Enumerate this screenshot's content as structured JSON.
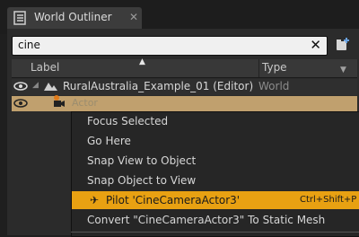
{
  "tab": {
    "title": "World Outliner",
    "close": "✕"
  },
  "search": {
    "value": "cine",
    "clear": "✕"
  },
  "columns": {
    "label": "Label",
    "type": "Type"
  },
  "rows": [
    {
      "label": "RuralAustralia_Example_01 (Editor)",
      "type": "World"
    },
    {
      "label": "Actor"
    }
  ],
  "menu": {
    "items": [
      {
        "label": "Focus Selected"
      },
      {
        "label": "Go Here"
      },
      {
        "label": "Snap View to Object"
      },
      {
        "label": "Snap Object to View"
      },
      {
        "label": "Pilot 'CineCameraActor3'",
        "shortcut": "Ctrl+Shift+P",
        "selected": true
      },
      {
        "label": "Convert \"CineCameraActor3\" To Static Mesh"
      }
    ]
  },
  "colors": {
    "highlight": "#e8a112",
    "selected_row": "#c0a06e",
    "panel": "#2b2b2b"
  }
}
